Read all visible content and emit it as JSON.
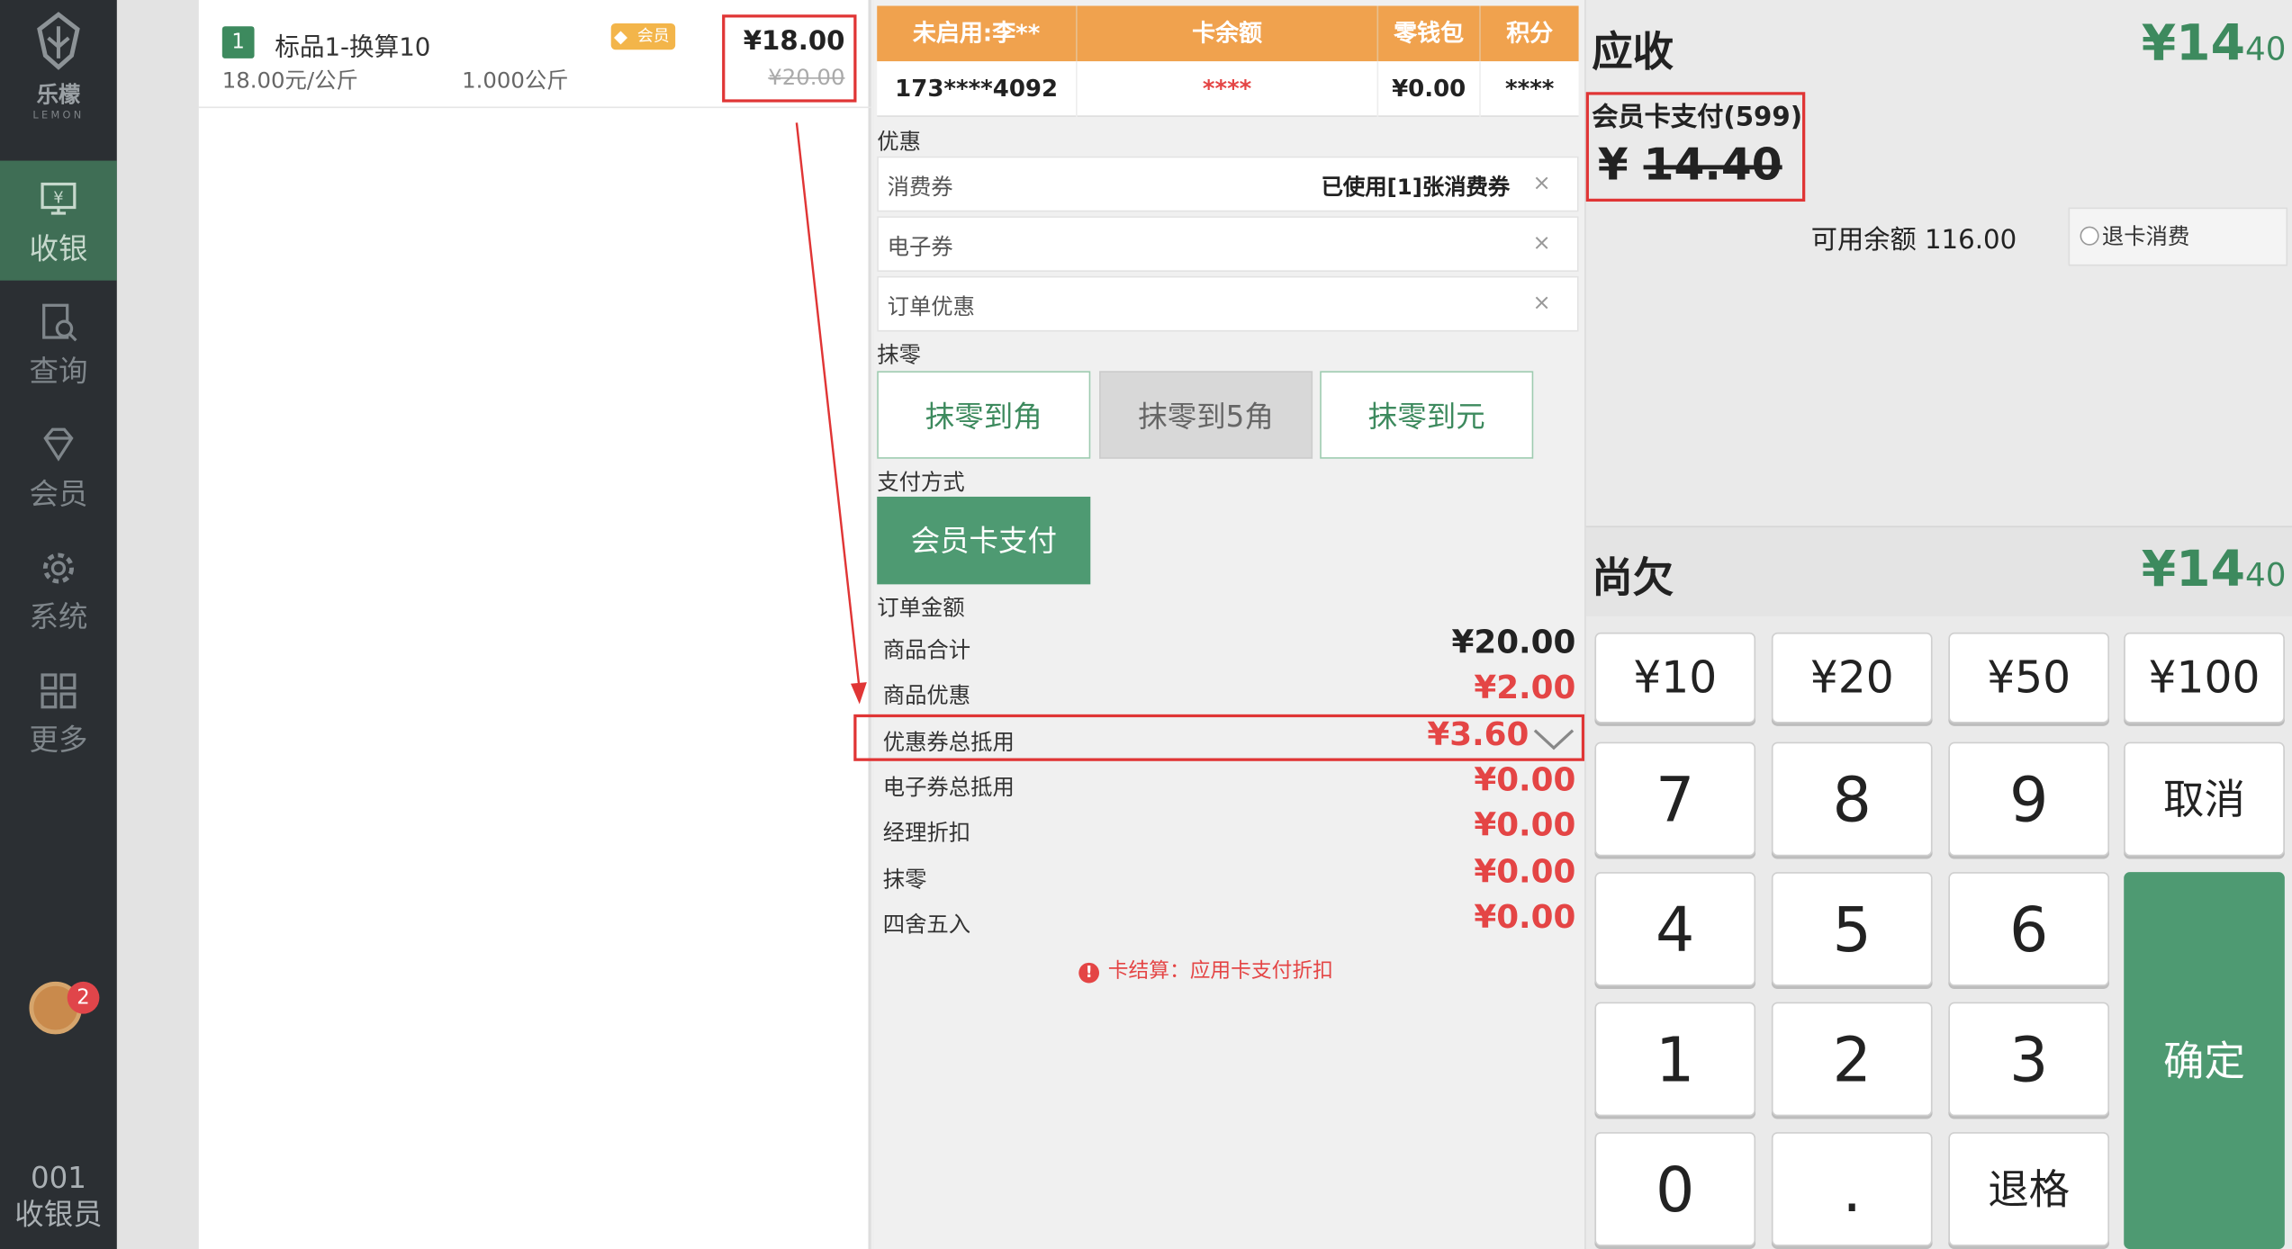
{
  "sidebar": {
    "logo_text": "乐檬",
    "logo_sub": "LEMON",
    "items": [
      {
        "label": "收银",
        "icon": "cash-register-icon"
      },
      {
        "label": "查询",
        "icon": "search-doc-icon"
      },
      {
        "label": "会员",
        "icon": "diamond-icon"
      },
      {
        "label": "系统",
        "icon": "gear-icon"
      },
      {
        "label": "更多",
        "icon": "grid-icon"
      }
    ],
    "notification_count": "2",
    "operator_id": "001",
    "operator_role": "收银员"
  },
  "product": {
    "index": "1",
    "name": "标品1-换算10",
    "badge": "会员",
    "unit_price": "18.00元/公斤",
    "quantity": "1.000公斤",
    "price": "¥18.00",
    "original_price": "¥20.00"
  },
  "member": {
    "headers": [
      "未启用:李**",
      "卡余额",
      "零钱包",
      "积分"
    ],
    "values": [
      "173****4092",
      "****",
      "¥0.00",
      "****"
    ]
  },
  "discount": {
    "section": "优惠",
    "voucher_label": "消费券",
    "voucher_value": "已使用[1]张消费券",
    "ecoupon_label": "电子券",
    "order_discount_label": "订单优惠",
    "clear": "×"
  },
  "rounding": {
    "section": "抹零",
    "options": [
      "抹零到角",
      "抹零到5角",
      "抹零到元"
    ]
  },
  "payment": {
    "section": "支付方式",
    "method": "会员卡支付"
  },
  "order": {
    "section": "订单金额",
    "rows": [
      {
        "label": "商品合计",
        "value": "¥20.00"
      },
      {
        "label": "商品优惠",
        "value": "¥2.00"
      },
      {
        "label": "优惠券总抵用",
        "value": "¥3.60"
      },
      {
        "label": "电子券总抵用",
        "value": "¥0.00"
      },
      {
        "label": "经理折扣",
        "value": "¥0.00"
      },
      {
        "label": "抹零",
        "value": "¥0.00"
      },
      {
        "label": "四舍五入",
        "value": "¥0.00"
      }
    ],
    "notice": "卡结算：应用卡支付折扣",
    "notice_icon": "!"
  },
  "summary": {
    "receivable_label": "应收",
    "receivable_main": "¥14",
    "receivable_decimal": "40",
    "card_pay_label": "会员卡支付(599)",
    "card_pay_currency": "¥",
    "card_pay_amount": "14.40",
    "available_balance": "可用余额 116.00",
    "refund_label": "退卡消费",
    "owed_label": "尚欠",
    "owed_main": "¥14",
    "owed_decimal": "40"
  },
  "keypad": {
    "money": [
      "¥10",
      "¥20",
      "¥50",
      "¥100"
    ],
    "row1": [
      "7",
      "8",
      "9"
    ],
    "row2": [
      "4",
      "5",
      "6"
    ],
    "row3": [
      "1",
      "2",
      "3"
    ],
    "row4": [
      "0",
      "."
    ],
    "cancel": "取消",
    "confirm": "确定",
    "backspace": "退格"
  },
  "colors": {
    "accent_green": "#3d8a5e",
    "header_orange": "#f0a24e",
    "alert_red": "#e44545",
    "sidebar_dark": "#2b2f33"
  }
}
